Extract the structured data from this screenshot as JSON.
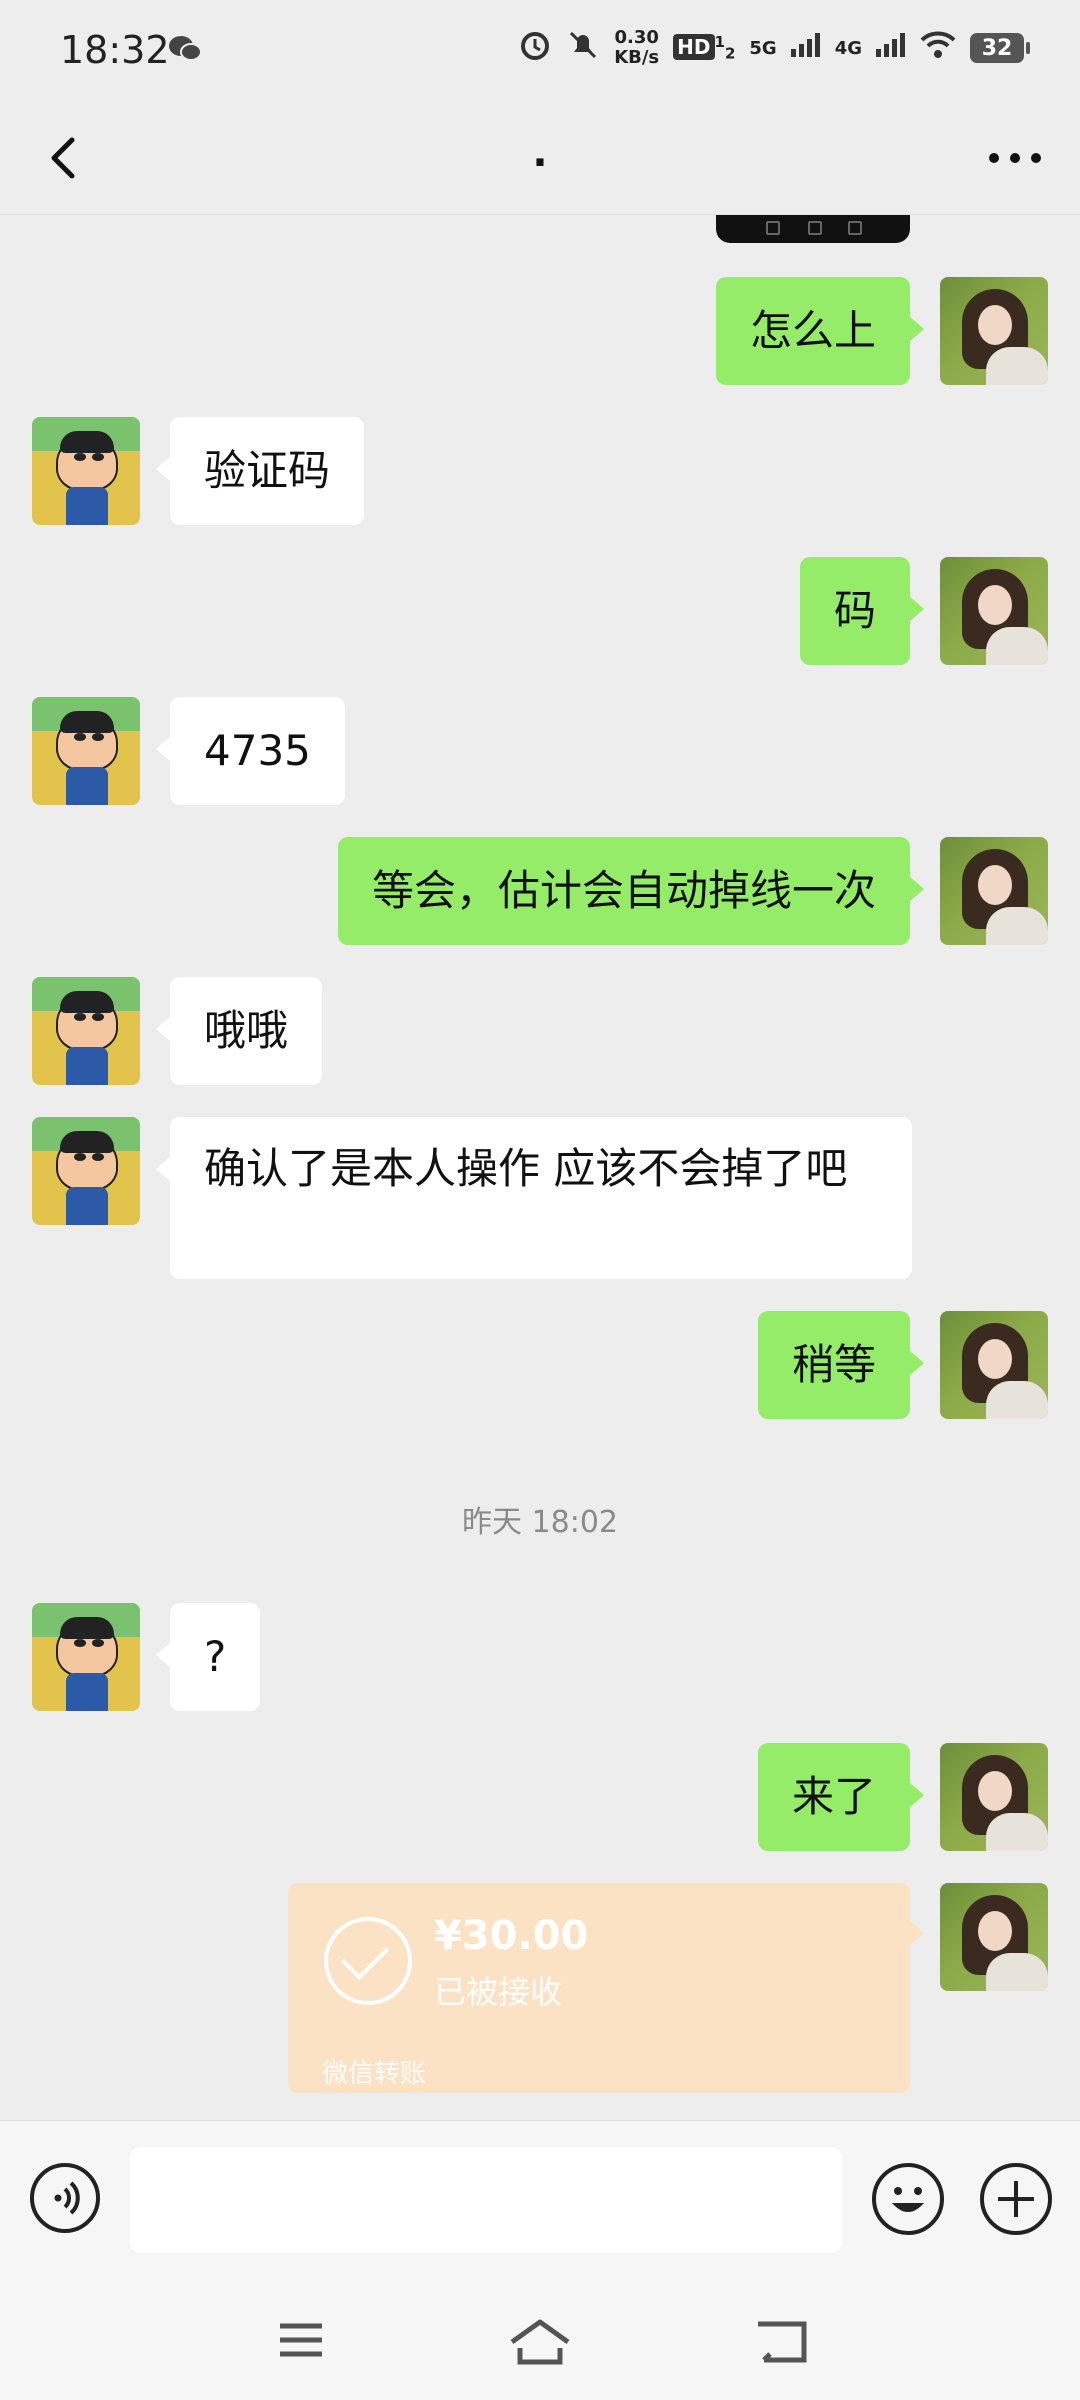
{
  "status_bar": {
    "time": "18:32",
    "net_speed_top": "0.30",
    "net_speed_bottom": "KB/s",
    "hd_label": "HD",
    "sim_top": "1",
    "sim_bottom": "2",
    "sig1": "5G",
    "sig2": "4G",
    "battery": "32",
    "icons": [
      "wechat-icon",
      "alarm-icon",
      "mute-icon",
      "wifi-icon",
      "battery-icon"
    ]
  },
  "header": {
    "title": "."
  },
  "messages": [
    {
      "side": "me",
      "text": "怎么上"
    },
    {
      "side": "them",
      "text": "验证码"
    },
    {
      "side": "me",
      "text": "码"
    },
    {
      "side": "them",
      "text": "4735"
    },
    {
      "side": "me",
      "text": "等会，估计会自动掉线一次"
    },
    {
      "side": "them",
      "text": "哦哦"
    },
    {
      "side": "them",
      "text": "确认了是本人操作 应该不会掉了吧"
    },
    {
      "side": "me",
      "text": "稍等"
    },
    {
      "side": "them",
      "text": "?"
    },
    {
      "side": "me",
      "text": "来了"
    }
  ],
  "timestamp": "昨天 18:02",
  "transfer": {
    "amount": "¥30.00",
    "status": "已被接收",
    "brand": "微信转账"
  },
  "input": {
    "value": "",
    "placeholder": ""
  },
  "colors": {
    "my_bubble": "#95ec69",
    "their_bubble": "#ffffff",
    "transfer": "#fbe2c4",
    "background": "#ededed"
  }
}
